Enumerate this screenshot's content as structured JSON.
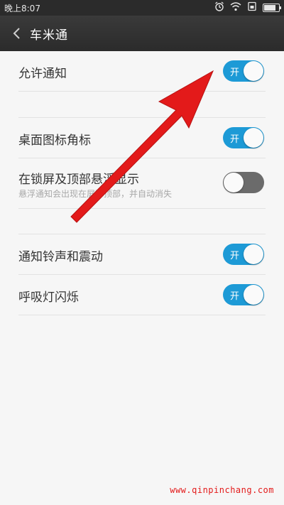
{
  "status_bar": {
    "time": "晚上8:07",
    "icons": [
      "alarm-icon",
      "wifi-icon",
      "sim-icon",
      "battery-icon"
    ],
    "battery_level": 0.8
  },
  "header": {
    "title": "车米通",
    "back_icon": "back-arrow-icon"
  },
  "settings": [
    {
      "id": "allow-notifications",
      "label": "允许通知",
      "toggle_text": "开",
      "enabled": true
    },
    {
      "id": "desktop-badge",
      "label": "桌面图标角标",
      "toggle_text": "开",
      "enabled": true
    },
    {
      "id": "lockscreen-float",
      "label": "在锁屏及顶部悬浮显示",
      "subtitle": "悬浮通知会出现在屏幕顶部，并自动消失",
      "enabled": false
    },
    {
      "id": "ring-vibrate",
      "label": "通知铃声和震动",
      "toggle_text": "开",
      "enabled": true
    },
    {
      "id": "breathing-light",
      "label": "呼吸灯闪烁",
      "toggle_text": "开",
      "enabled": true
    }
  ],
  "watermark": "www.qinpinchang.com",
  "colors": {
    "toggle_on": "#1d9ad6",
    "toggle_off": "#6b6b6b",
    "annotation_arrow": "#e31a1a",
    "title_bar": "#2b2b2b"
  }
}
